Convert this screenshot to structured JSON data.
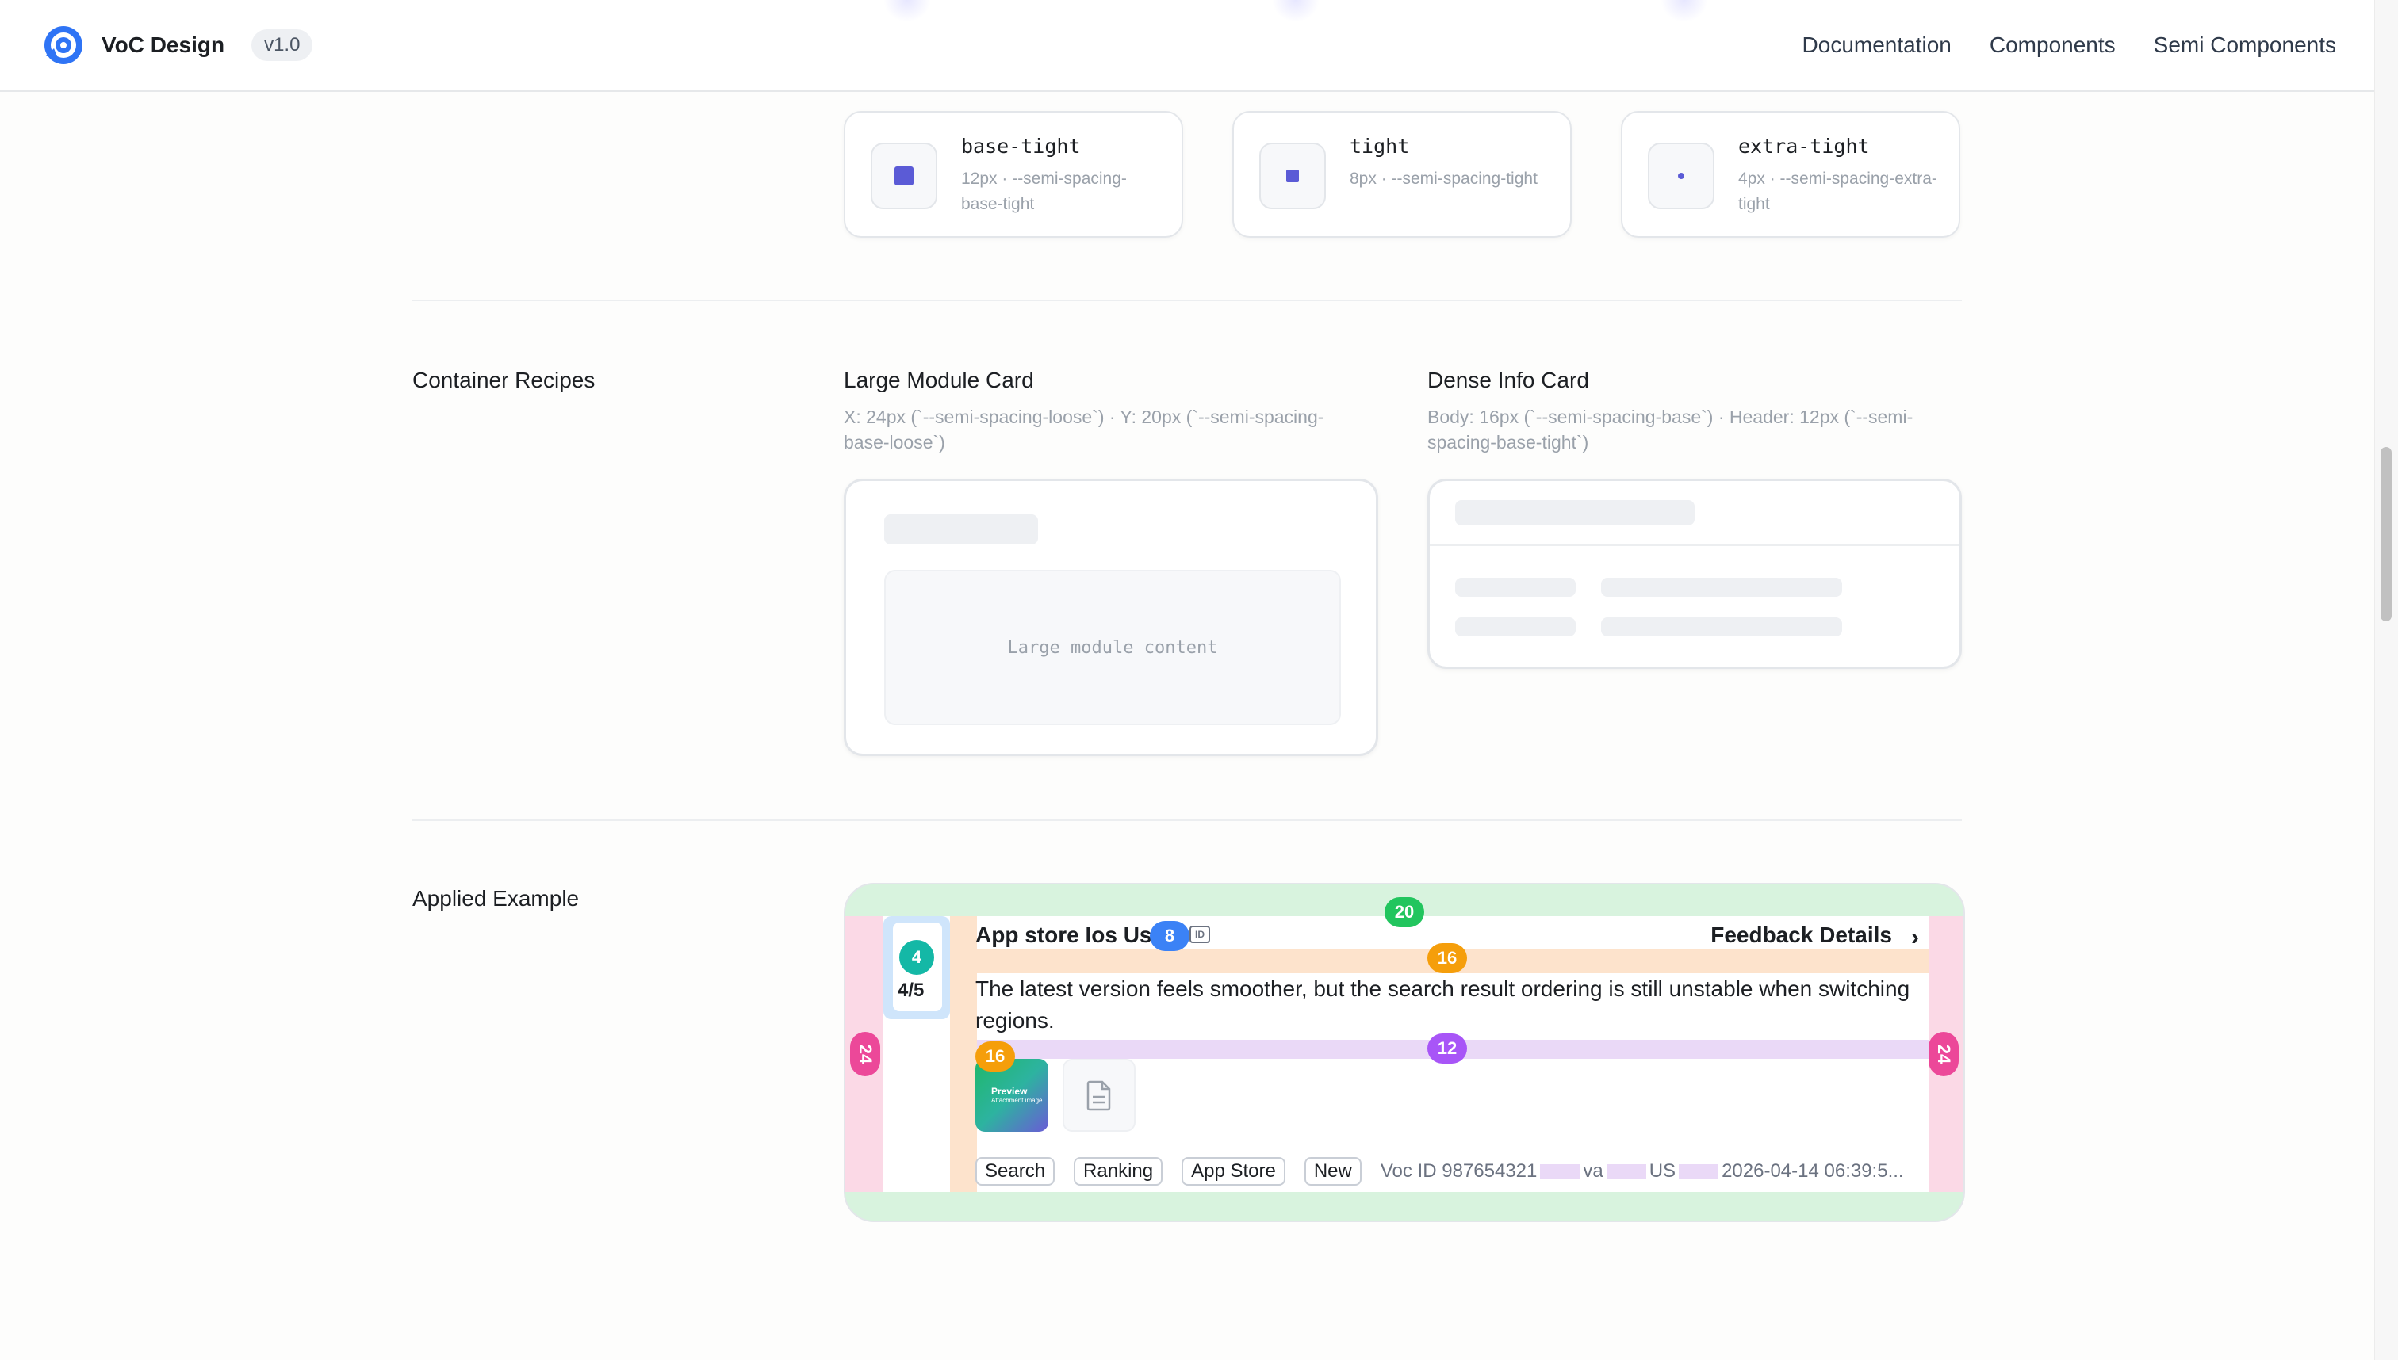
{
  "header": {
    "brand": "VoC Design",
    "version": "v1.0",
    "nav": [
      "Documentation",
      "Components",
      "Semi Components"
    ]
  },
  "spacing_tokens": [
    {
      "name": "base-tight",
      "desc": "12px · --semi-spacing-base-tight"
    },
    {
      "name": "tight",
      "desc": "8px · --semi-spacing-tight"
    },
    {
      "name": "extra-tight",
      "desc": "4px · --semi-spacing-extra-tight"
    }
  ],
  "container_recipes": {
    "label": "Container Recipes",
    "large": {
      "title": "Large Module Card",
      "desc": "X: 24px (`--semi-spacing-loose`) · Y: 20px (`--semi-spacing-base-loose`)",
      "content": "Large module content"
    },
    "dense": {
      "title": "Dense Info Card",
      "desc": "Body: 16px (`--semi-spacing-base`) · Header: 12px (`--semi-spacing-base-tight`)"
    }
  },
  "applied_example": {
    "label": "Applied Example",
    "source_title": "App store Ios Us",
    "details_label": "Feedback Details",
    "avatar_number": "4",
    "score": "4/5",
    "body": "The latest version feels smoother, but the search result ordering is still unstable when switching regions.",
    "thumb_label": "Preview",
    "thumb_sub": "Attachment image",
    "tags": [
      "Search",
      "Ranking",
      "App Store",
      "New"
    ],
    "meta": {
      "voc_id": "Voc ID 987654321",
      "m2": "va",
      "m3": "US",
      "time": "2026-04-14 06:39:5..."
    },
    "badges": {
      "top": "20",
      "title_gap": "8",
      "header_gap": "16",
      "content_gap": "12",
      "side_gap": "16",
      "left": "24",
      "right": "24"
    },
    "colors": {
      "green": "#22c55e",
      "orange": "#f59e0b",
      "purple": "#a855f7",
      "pink": "#ec4899",
      "blue": "#3b82f6",
      "teal": "#14b8a6"
    }
  }
}
